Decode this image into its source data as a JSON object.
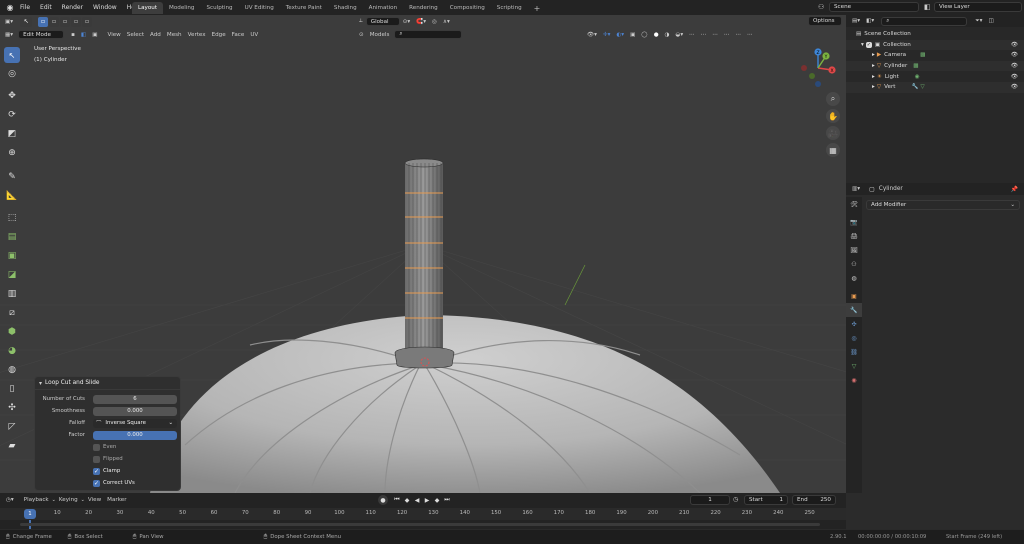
{
  "topbar": {
    "menus": [
      "File",
      "Edit",
      "Render",
      "Window",
      "Help"
    ],
    "workspaces": [
      "Layout",
      "Modeling",
      "Sculpting",
      "UV Editing",
      "Texture Paint",
      "Shading",
      "Animation",
      "Rendering",
      "Compositing",
      "Scripting"
    ],
    "active_workspace": "Layout",
    "add_tab": "+",
    "scene_label": "Scene",
    "view_layer_label": "View Layer"
  },
  "viewport": {
    "mode": "Edit Mode",
    "menus": [
      "View",
      "Select",
      "Add",
      "Mesh",
      "Vertex",
      "Edge",
      "Face",
      "UV"
    ],
    "orientation": "Global",
    "snap_target": "Models",
    "options_label": "Options",
    "view_name": "User Perspective",
    "object_name": "(1) Cylinder"
  },
  "navigation_gizmo": {
    "x": "X",
    "y": "Y",
    "z": "Z"
  },
  "operator_panel": {
    "title": "Loop Cut and Slide",
    "number_of_cuts_label": "Number of Cuts",
    "number_of_cuts": "6",
    "smoothness_label": "Smoothness",
    "smoothness": "0.000",
    "falloff_label": "Falloff",
    "falloff": "Inverse Square",
    "factor_label": "Factor",
    "factor": "0.000",
    "even_label": "Even",
    "even_checked": false,
    "flipped_label": "Flipped",
    "flipped_checked": false,
    "clamp_label": "Clamp",
    "clamp_checked": true,
    "correct_uvs_label": "Correct UVs",
    "correct_uvs_checked": true
  },
  "outliner": {
    "scene_collection": "Scene Collection",
    "collection": "Collection",
    "items": [
      {
        "name": "Camera",
        "icon": "camera-icon",
        "color": "#e89b50"
      },
      {
        "name": "Cylinder",
        "icon": "mesh-icon",
        "color": "#e89b50"
      },
      {
        "name": "Light",
        "icon": "light-icon",
        "color": "#e89b50"
      },
      {
        "name": "Vert",
        "icon": "mesh-icon",
        "color": "#e89b50"
      }
    ]
  },
  "properties": {
    "object_name": "Cylinder",
    "add_modifier": "Add Modifier"
  },
  "timeline": {
    "menus": [
      "Playback",
      "Keying",
      "View",
      "Marker"
    ],
    "current_frame": "1",
    "start_label": "Start",
    "start": "1",
    "end_label": "End",
    "end": "250",
    "ruler": [
      "1",
      "10",
      "20",
      "30",
      "40",
      "50",
      "60",
      "70",
      "80",
      "90",
      "100",
      "110",
      "120",
      "130",
      "140",
      "150",
      "160",
      "170",
      "180",
      "190",
      "200",
      "210",
      "220",
      "230",
      "240",
      "250"
    ]
  },
  "statusbar": {
    "items": [
      "Change Frame",
      "Box Select",
      "Pan View",
      "Dope Sheet Context Menu"
    ],
    "version": "2.90.1",
    "time": "00:00:00:00 / 00:00:10:09",
    "frame_info": "Start Frame (249 left)"
  },
  "colors": {
    "accent": "#4772b3",
    "active_tool": "#4772b3",
    "object_orange": "#e89b50",
    "axis_x": "#e04848",
    "axis_y": "#7cb340",
    "axis_z": "#3d86d8"
  }
}
